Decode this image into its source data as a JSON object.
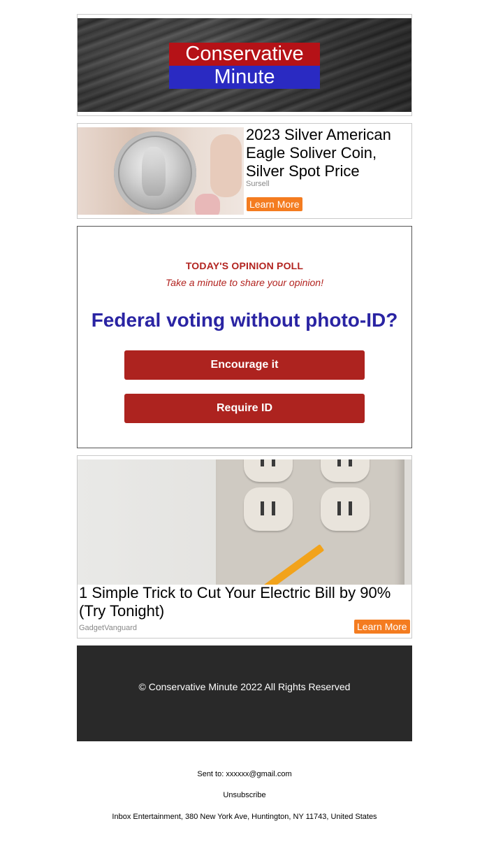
{
  "header": {
    "logo_top": "Conservative",
    "logo_bottom": "Minute",
    "colors": {
      "logo_red": "#b51217",
      "logo_blue": "#2a2ac2"
    }
  },
  "ads": [
    {
      "title": "2023 Silver American Eagle Soliver Coin, Silver Spot Price",
      "source": "Sursell",
      "cta": "Learn More",
      "image": "silver-coin-in-hand"
    },
    {
      "title": "1 Simple Trick to Cut Your Electric Bill by 90% (Try Tonight)",
      "source": "GadgetVanguard",
      "cta": "Learn More",
      "image": "pencil-in-wall-outlet"
    }
  ],
  "poll": {
    "kicker": "TODAY'S OPINION POLL",
    "subtitle": "Take a minute to share your opinion!",
    "question": "Federal voting without photo-ID?",
    "options": [
      "Encourage it",
      "Require ID"
    ],
    "colors": {
      "accent": "#ad231f",
      "question": "#2a24a3"
    }
  },
  "footer": {
    "copyright": "© Conservative Minute 2022 All Rights Reserved"
  },
  "meta": {
    "sent_to": "Sent to: xxxxxx@gmail.com",
    "unsubscribe": "Unsubscribe",
    "address": "Inbox Entertainment, 380 New York Ave, Huntington, NY 11743, United States"
  },
  "colors": {
    "cta_orange": "#f47c20",
    "footer_bg": "#292929"
  }
}
